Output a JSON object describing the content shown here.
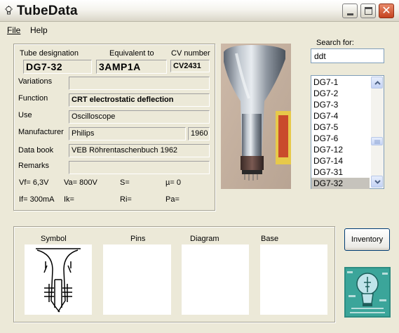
{
  "window": {
    "title": "TubeData"
  },
  "menu": {
    "file": "File",
    "help": "Help"
  },
  "tube": {
    "designation_label": "Tube designation",
    "designation": "DG7-32",
    "equivalent_label": "Equivalent to",
    "equivalent": "3AMP1A",
    "cv_label": "CV number",
    "cv": "CV2431",
    "variations_label": "Variations",
    "variations": "",
    "function_label": "Function",
    "function": "CRT electrostatic deflection",
    "use_label": "Use",
    "use": "Oscilloscope",
    "manufacturer_label": "Manufacturer",
    "manufacturer": "Philips",
    "year": "1960",
    "databook_label": "Data book",
    "databook": "VEB Röhrentaschenbuch 1962",
    "remarks_label": "Remarks",
    "remarks": ""
  },
  "params": {
    "vf": "Vf= 6,3V",
    "va": "Va= 800V",
    "s": "S=",
    "mu": "µ=   0",
    "if": "If= 300mA",
    "ik": "Ik=",
    "ri": "Ri=",
    "pa": "Pa="
  },
  "search": {
    "label": "Search for:",
    "value": "ddt",
    "items": [
      "DG7-1",
      "DG7-2",
      "DG7-3",
      "DG7-4",
      "DG7-5",
      "DG7-6",
      "DG7-12",
      "DG7-14",
      "DG7-31",
      "DG7-32"
    ],
    "selected": "DG7-32"
  },
  "bottom": {
    "symbol_label": "Symbol",
    "pins_label": "Pins",
    "diagram_label": "Diagram",
    "base_label": "Base",
    "inventory_button": "Inventory"
  },
  "colors": {
    "selection": "#C6C3BC",
    "close_button": "#D3542C",
    "title_bar": "#ECE9D8"
  },
  "icons": [
    "lightbulb-icon",
    "minimize-icon",
    "maximize-icon",
    "close-icon",
    "scroll-up-icon",
    "scroll-down-icon",
    "scroll-thumb-icon"
  ]
}
